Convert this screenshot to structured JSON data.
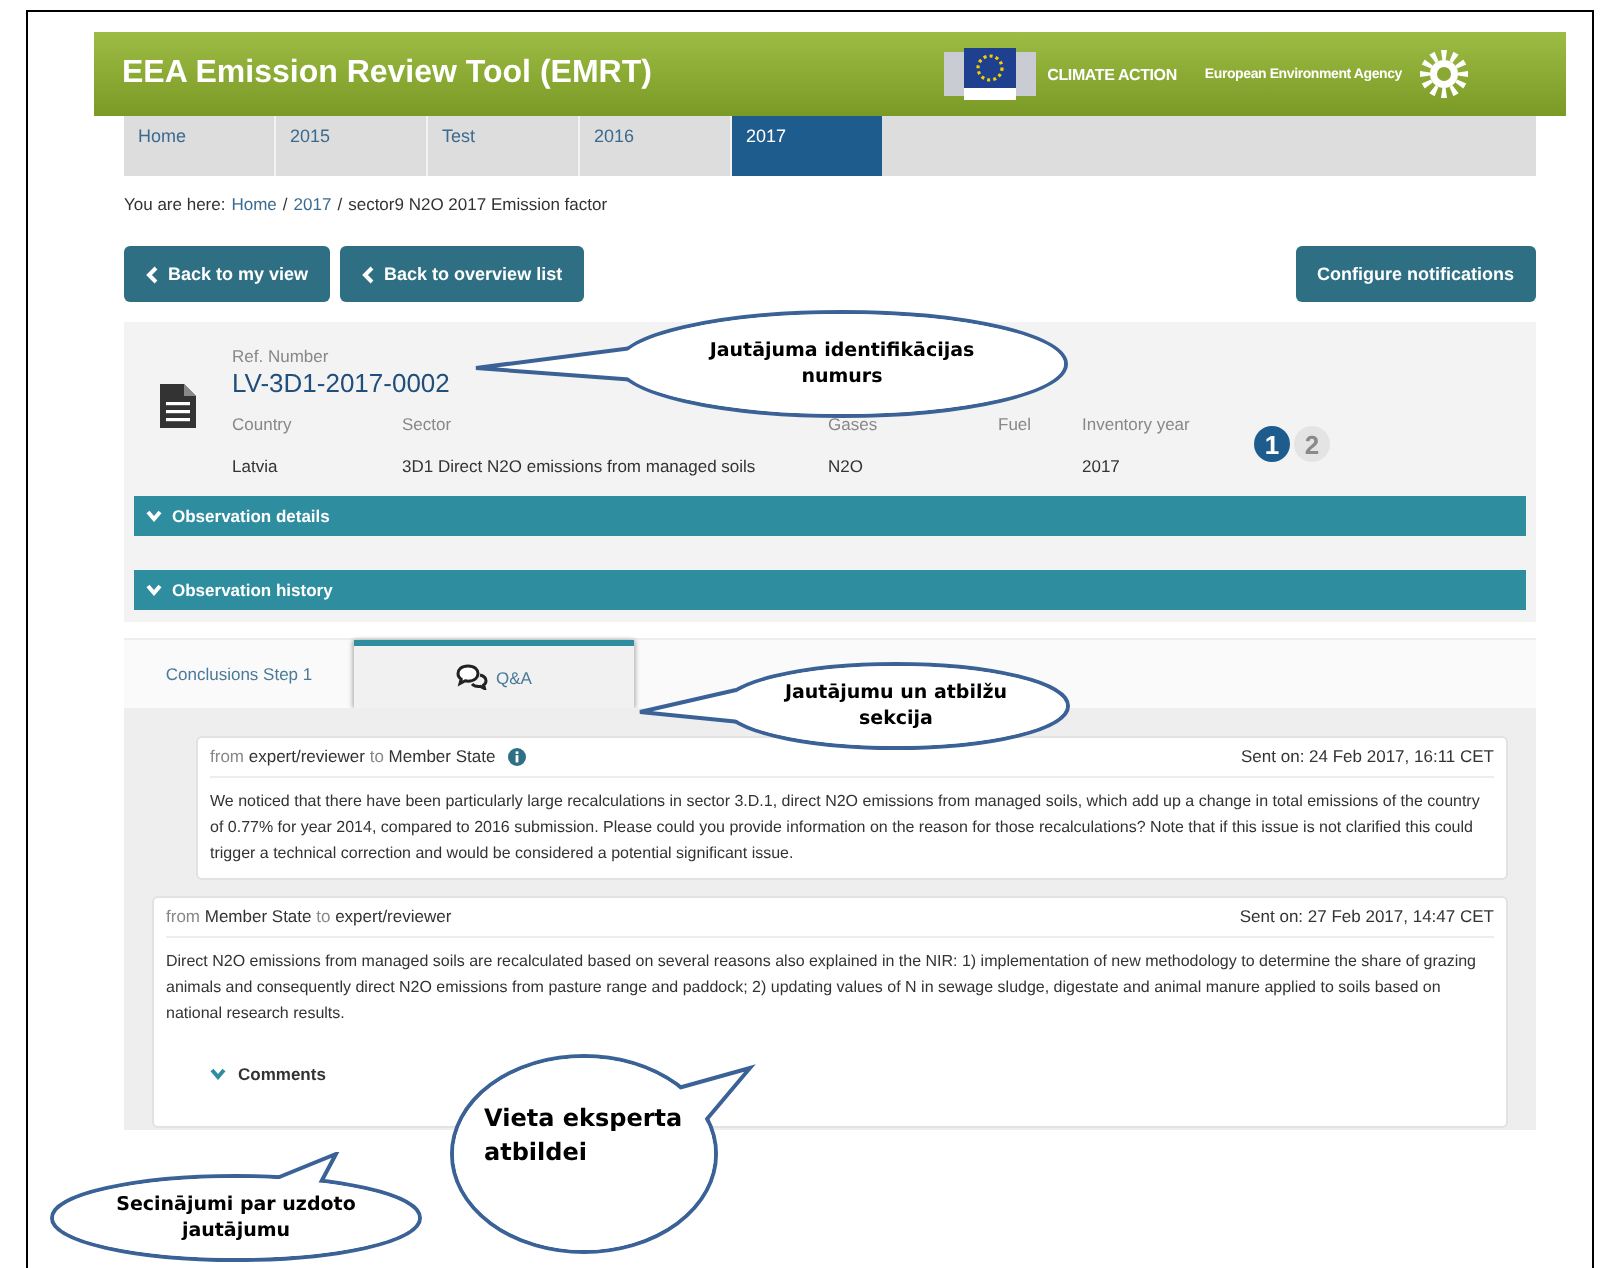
{
  "header": {
    "title": "EEA Emission Review Tool (EMRT)",
    "partners": [
      "CLIMATE ACTION",
      "European Environment Agency"
    ]
  },
  "nav": [
    {
      "label": "Home",
      "selected": false
    },
    {
      "label": "2015",
      "selected": false
    },
    {
      "label": "Test",
      "selected": false
    },
    {
      "label": "2016",
      "selected": false
    },
    {
      "label": "2017",
      "selected": true
    }
  ],
  "breadcrumb": {
    "prefix": "You are here:",
    "separator": "/",
    "links": [
      "Home",
      "2017"
    ],
    "current": "sector9 N2O 2017 Emission factor"
  },
  "actions": [
    {
      "label": "Back to my view",
      "kind": "back"
    },
    {
      "label": "Back to overview list",
      "kind": "back"
    },
    {
      "label": "Configure notifications",
      "kind": "plain"
    }
  ],
  "observation": {
    "ref_label": "Ref. Number",
    "ref_number": "LV-3D1-2017-0002",
    "fields": [
      {
        "label": "Country",
        "value": "Latvia"
      },
      {
        "label": "Sector",
        "value": "3D1 Direct N2O emissions from managed soils"
      },
      {
        "label": "Gases",
        "value": "N2O"
      },
      {
        "label": "Fuel"
      },
      {
        "label": "Inventory year",
        "value": "2017"
      }
    ],
    "steps": [
      {
        "label": "1",
        "selected": true
      },
      {
        "label": "2",
        "selected": false
      }
    ]
  },
  "sections": [
    {
      "label": "Observation details"
    },
    {
      "label": "Observation history"
    }
  ],
  "tabs": [
    {
      "label": "Conclusions Step 1",
      "selected": false,
      "kind": "text"
    },
    {
      "label": "Q&A",
      "selected": true,
      "kind": "chat"
    }
  ],
  "messages": [
    {
      "from": "from",
      "sender": "expert/reviewer",
      "to": "to",
      "recipient": "Member State",
      "info": true,
      "sent": "Sent on: 24 Feb 2017, 16:11 CET",
      "text": "We noticed that there have been particularly large recalculations in sector 3.D.1, direct N2O emissions from managed soils, which add up a change in total emissions of the country of 0.77% for year 2014, compared to 2016 submission. Please could you provide information on the reason for those recalculations? Note that if this issue is not clarified this could trigger a technical correction and would be considered a potential significant issue."
    },
    {
      "from": "from",
      "sender": "Member State",
      "to": "to",
      "recipient": "expert/reviewer",
      "info": false,
      "sent": "Sent on: 27 Feb 2017, 14:47 CET",
      "text": "Direct N2O emissions from managed soils are recalculated based on several reasons also explained in the NIR: 1) implementation of new methodology to determine the share of grazing animals and consequently direct N2O emissions from pasture range and paddock; 2) updating values of N in sewage sludge, digestate and animal manure applied to soils based on national research results.",
      "comments": "Comments"
    }
  ],
  "callouts": [
    "Jautājuma identifikācijas numurs",
    "Jautājumu un atbilžu sekcija",
    "Secinājumi par uzdoto jautājumu",
    "Vieta eksperta atbildei"
  ]
}
